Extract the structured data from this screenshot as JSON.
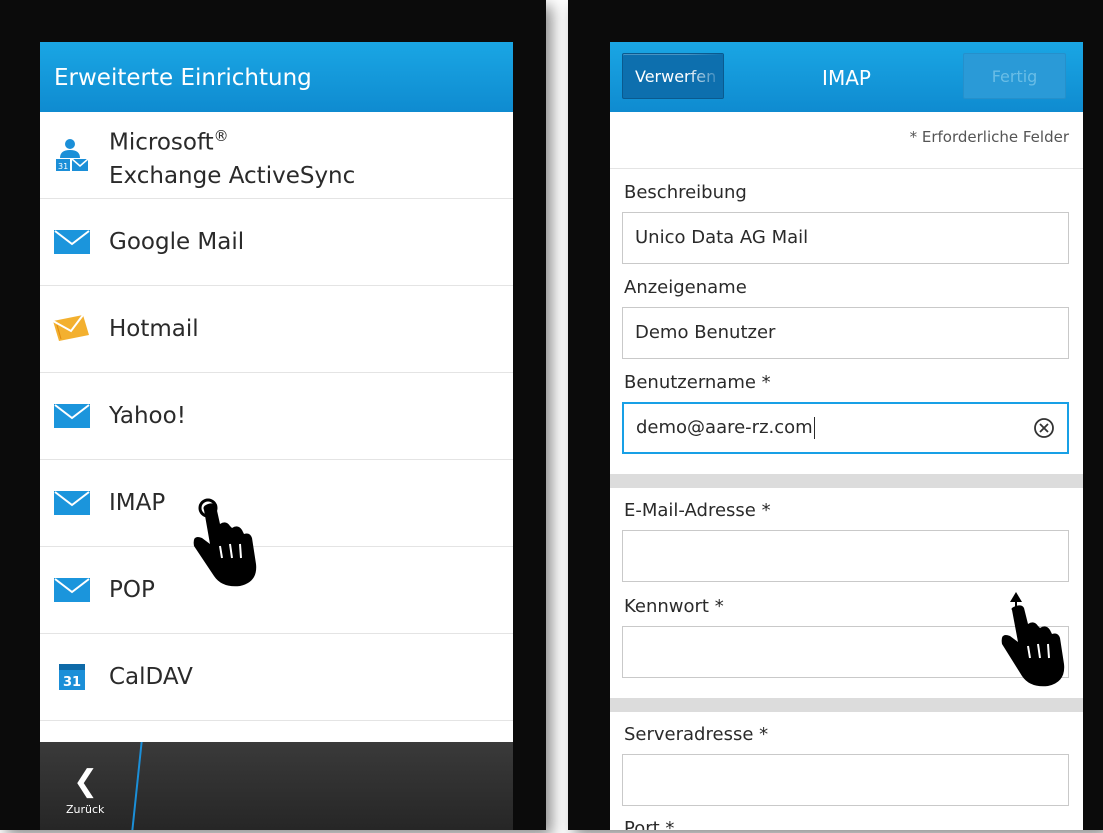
{
  "left_screen": {
    "title": "Erweiterte Einrichtung",
    "accounts": [
      {
        "label_line1": "Microsoft",
        "label_sup": "®",
        "label_line2": "Exchange ActiveSync",
        "icon": "exchange-icon"
      },
      {
        "label": "Google Mail",
        "icon": "mail-icon"
      },
      {
        "label": "Hotmail",
        "icon": "hotmail-icon"
      },
      {
        "label": "Yahoo!",
        "icon": "mail-icon"
      },
      {
        "label": "IMAP",
        "icon": "mail-icon"
      },
      {
        "label": "POP",
        "icon": "mail-icon"
      },
      {
        "label": "CalDAV",
        "icon": "calendar-icon",
        "icon_text": "31"
      }
    ],
    "back_label": "Zurück",
    "gesture": "tap-hand-icon"
  },
  "right_screen": {
    "title": "IMAP",
    "discard_label": "Verwerfen",
    "done_label": "Fertig",
    "required_note": "* Erforderliche Felder",
    "fields": {
      "description": {
        "label": "Beschreibung",
        "value": "Unico Data AG Mail"
      },
      "display_name": {
        "label": "Anzeigename",
        "value": "Demo Benutzer"
      },
      "username": {
        "label": "Benutzername *",
        "value": "demo@aare-rz.com"
      },
      "email": {
        "label": "E-Mail-Adresse *",
        "value": ""
      },
      "password": {
        "label": "Kennwort *",
        "value": ""
      },
      "server": {
        "label": "Serveradresse *",
        "value": ""
      },
      "port": {
        "label": "Port *"
      }
    },
    "gesture": "swipe-up-hand-icon"
  },
  "colors": {
    "titlebar": "#1aa6e4",
    "accent": "#18a0e6",
    "actionbar": "#2e2e2e",
    "hotmail": "#f0a020"
  }
}
